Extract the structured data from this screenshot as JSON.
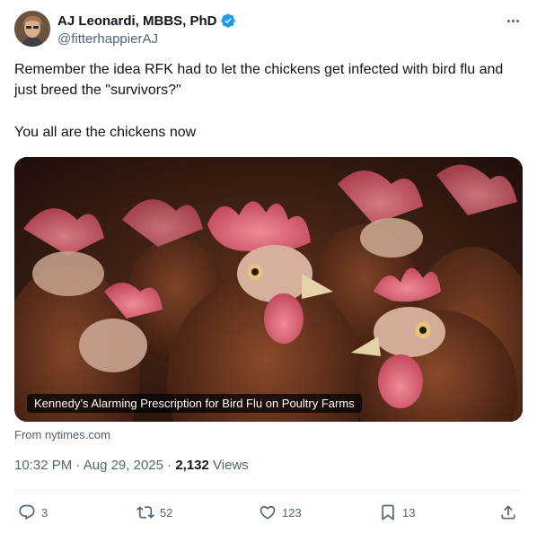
{
  "author": {
    "display_name": "AJ Leonardi, MBBS, PhD",
    "handle": "@fitterhappierAJ",
    "verified": true,
    "verified_color": "#1d9bf0"
  },
  "tweet": {
    "line1": "Remember the idea RFK had to let the chickens get infected with bird flu and just breed the \"survivors?\"",
    "line2": "You all are the chickens now"
  },
  "card": {
    "caption": "Kennedy’s Alarming Prescription for Bird Flu on Poultry Farms",
    "source": "From nytimes.com"
  },
  "meta": {
    "time": "10:32 PM",
    "separator1": "·",
    "date": "Aug 29, 2025",
    "separator2": "·",
    "views_count": "2,132",
    "views_label": "Views"
  },
  "actions": {
    "reply_count": "3",
    "retweet_count": "52",
    "like_count": "123",
    "bookmark_count": "13"
  },
  "icons": {
    "more": "more-horizontal-icon",
    "reply": "reply-icon",
    "retweet": "retweet-icon",
    "like": "heart-icon",
    "bookmark": "bookmark-icon",
    "share": "share-icon"
  },
  "colors": {
    "text_primary": "#0f1419",
    "text_secondary": "#536471",
    "divider": "#eff3f4"
  }
}
